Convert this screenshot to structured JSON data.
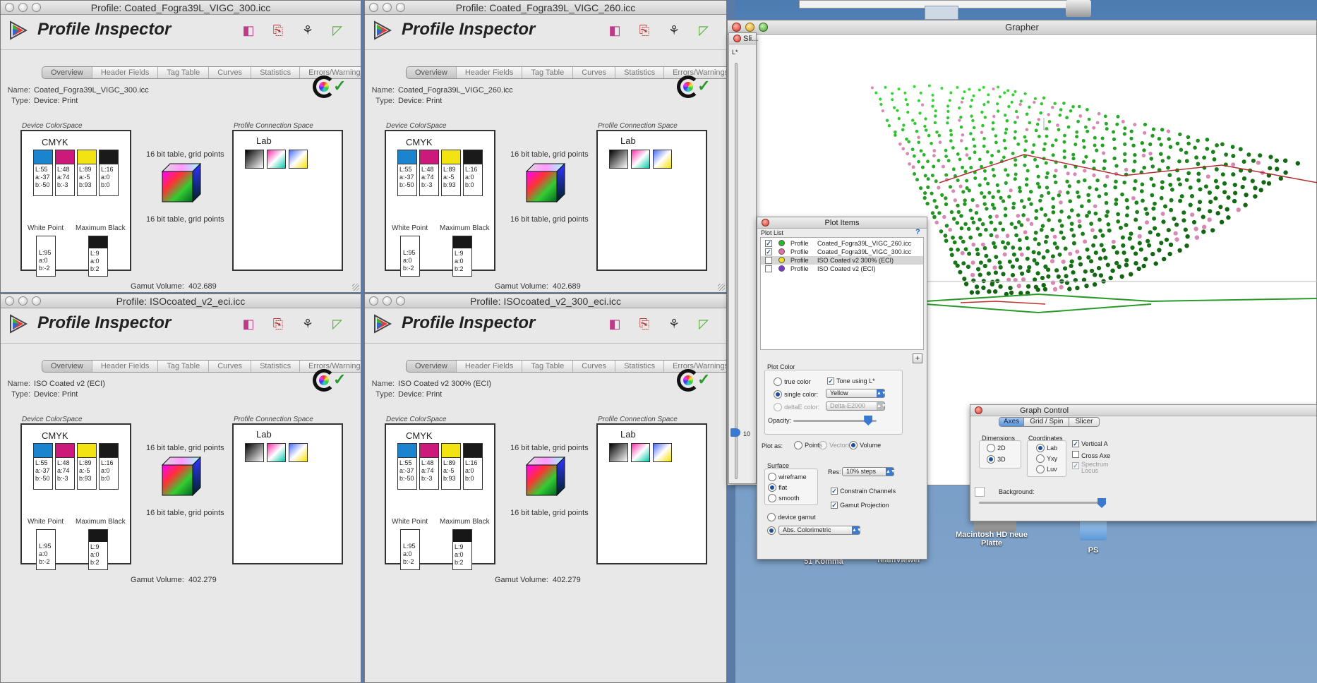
{
  "app_name": "Profile Inspector",
  "tabs": [
    "Overview",
    "Header Fields",
    "Tag Table",
    "Curves",
    "Statistics",
    "Errors/Warnings"
  ],
  "labels": {
    "name": "Name:",
    "type": "Type:",
    "device_colorspace": "Device ColorSpace",
    "pcs": "Profile Connection Space",
    "cmyk": "CMYK",
    "lab": "Lab",
    "white_point": "White Point",
    "maximum_black": "Maximum Black",
    "bit_table": "16 bit table,  grid points",
    "gamut_volume": "Gamut Volume:"
  },
  "colors": {
    "cyan": "#1a84cf",
    "magenta": "#cc1a7a",
    "yellow": "#f2e312",
    "black": "#1a1a1a"
  },
  "chips": {
    "c": [
      "L:55",
      "a:-37",
      "b:-50"
    ],
    "m": [
      "L:48",
      "a:74",
      "b:-3"
    ],
    "y": [
      "L:89",
      "a:-5",
      "b:93"
    ],
    "k": [
      "L:16",
      "a:0",
      "b:0"
    ],
    "wp": [
      "L:95",
      "a:0",
      "b:-2"
    ],
    "mb": [
      "L:9",
      "a:0",
      "b:2"
    ]
  },
  "windows": [
    {
      "title": "Profile: Coated_Fogra39L_VIGC_300.icc",
      "name": "Coated_Fogra39L_VIGC_300.icc",
      "type": "Device: Print",
      "gamut": "402.689"
    },
    {
      "title": "Profile: Coated_Fogra39L_VIGC_260.icc",
      "name": "Coated_Fogra39L_VIGC_260.icc",
      "type": "Device: Print",
      "gamut": "402.689"
    },
    {
      "title": "Profile: ISOcoated_v2_eci.icc",
      "name": "ISO Coated v2 (ECI)",
      "type": "Device: Print",
      "gamut": "402.279"
    },
    {
      "title": "Profile: ISOcoated_v2_300_eci.icc",
      "name": "ISO Coated v2 300% (ECI)",
      "type": "Device: Print",
      "gamut": "402.279"
    }
  ],
  "grapher": {
    "title": "Grapher",
    "slicer_title": "Sli...",
    "slicer_axis": "L*",
    "slicer_value": "10",
    "axis_l": "L"
  },
  "plot_items": {
    "title": "Plot Items",
    "list_label": "Plot List",
    "help": "?",
    "rows": [
      {
        "checked": true,
        "color": "#27b827",
        "kind": "Profile",
        "name": "Coated_Fogra39L_VIGC_260.icc"
      },
      {
        "checked": true,
        "color": "#e4709e",
        "kind": "Profile",
        "name": "Coated_Fogra39L_VIGC_300.icc"
      },
      {
        "checked": false,
        "color": "#f0e020",
        "kind": "Profile",
        "name": "ISO Coated v2 300% (ECI)"
      },
      {
        "checked": false,
        "color": "#7a3ad0",
        "kind": "Profile",
        "name": "ISO Coated v2 (ECI)"
      }
    ],
    "add_button": "+",
    "plot_color_label": "Plot Color",
    "true_color": "true color",
    "tone_using": "Tone using L*",
    "single_color": "single color:",
    "single_color_value": "Yellow",
    "delta_e": "deltaE color:",
    "delta_e_value": "Delta-E2000",
    "opacity": "Opacity:",
    "opacity_level": 0.9,
    "plot_as": "Plot as:",
    "points": "Points",
    "vectors": "Vectors",
    "volume": "Volume",
    "surface": "Surface",
    "wireframe": "wireframe",
    "flat": "flat",
    "smooth": "smooth",
    "res_label": "Res:",
    "res_value": "10% steps",
    "constrain": "Constrain Channels",
    "gamut_projection": "Gamut Projection",
    "device_gamut": "device gamut",
    "intent_value": "Abs. Colorimetric"
  },
  "graph_control": {
    "title": "Graph Control",
    "tabs": [
      "Axes",
      "Grid / Spin",
      "Slicer"
    ],
    "dimensions": "Dimensions",
    "d2": "2D",
    "d3": "3D",
    "coordinates": "Coordinates",
    "lab": "Lab",
    "yxy": "Yxy",
    "luv": "Luv",
    "vertical": "Vertical A",
    "cross": "Cross Axe",
    "spectrum": "Spectrum Locus",
    "background": "Background:"
  },
  "desktop": {
    "hd_label": "Macintosh HD neue Platte",
    "ps_label": "PS",
    "label_51": "51 Komma",
    "label_tv": "TeamViewer"
  }
}
